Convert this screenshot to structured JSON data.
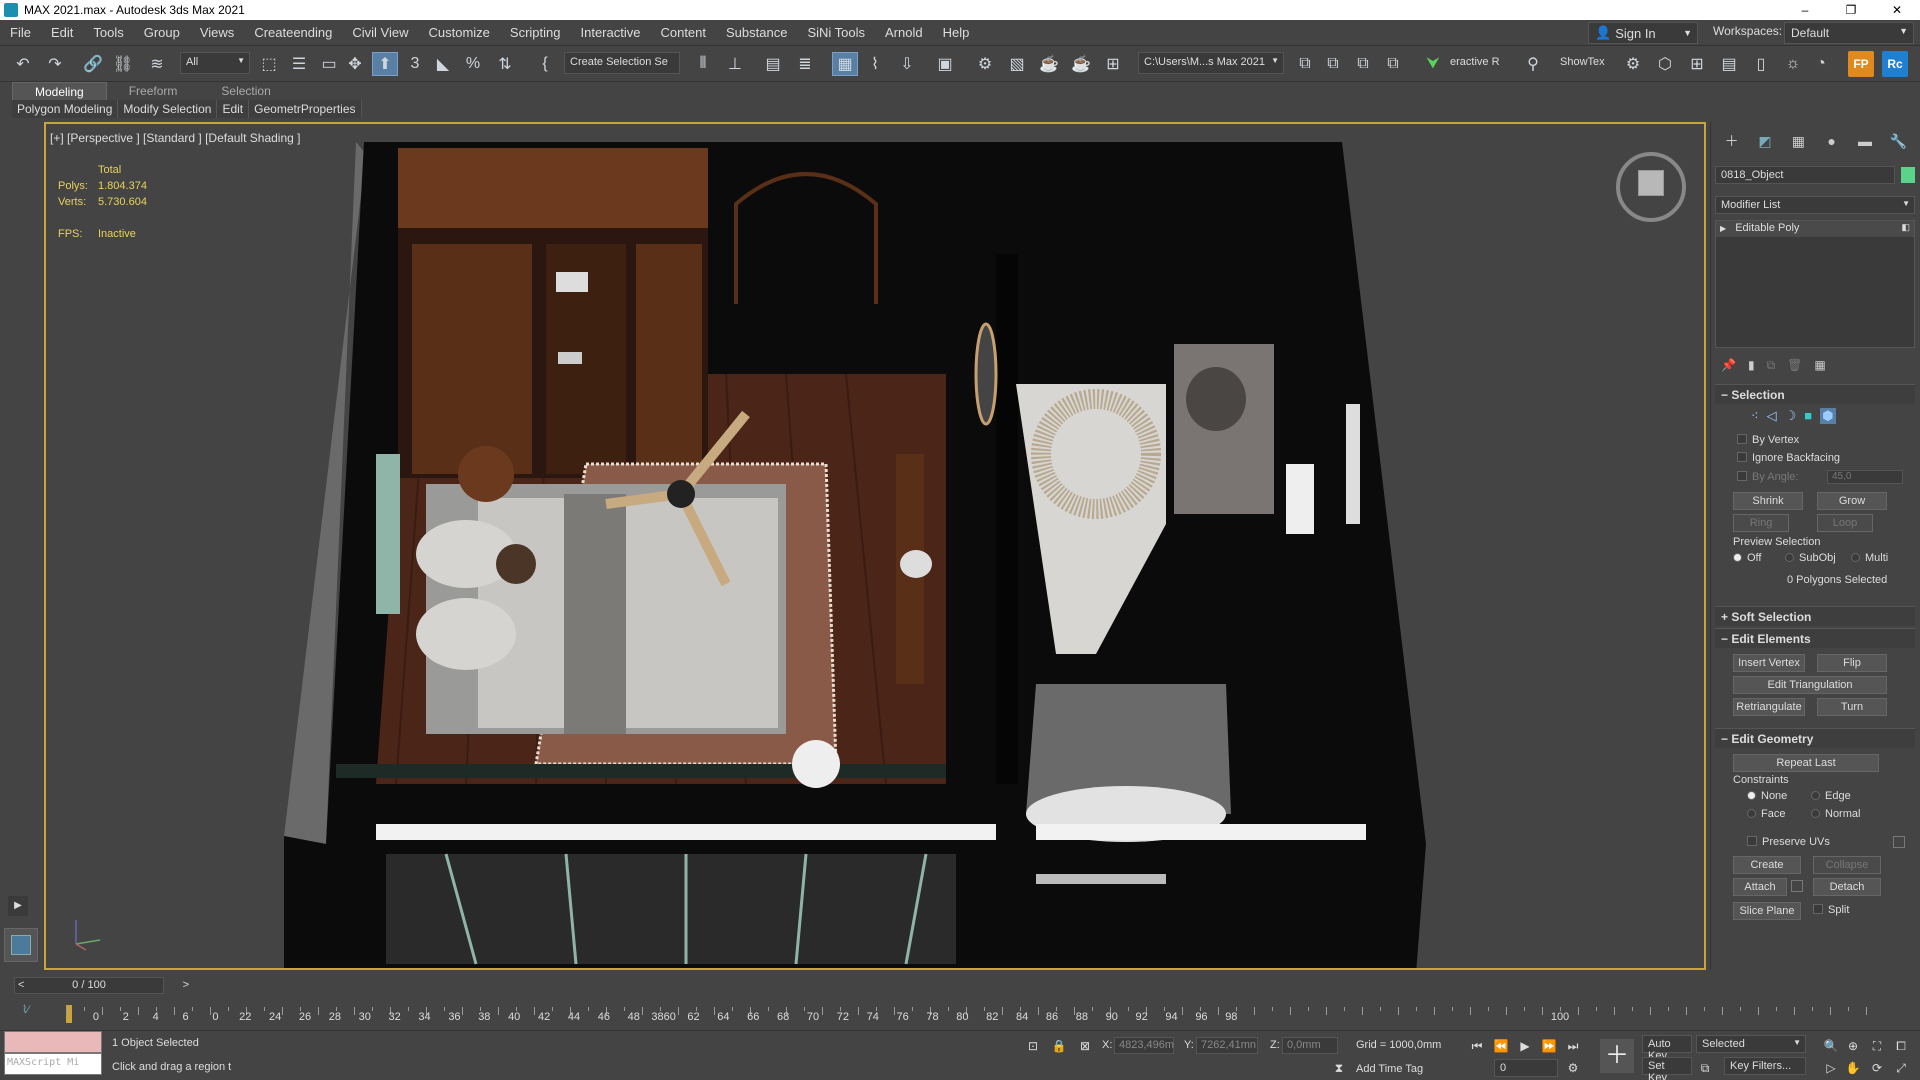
{
  "window": {
    "title": "MAX 2021.max - Autodesk 3ds Max 2021",
    "controls": [
      "–",
      "❐",
      "✕"
    ]
  },
  "menu": {
    "items": [
      "File",
      "Edit",
      "Tools",
      "Group",
      "Views",
      "Createending",
      "Civil View",
      "Customize",
      "Scripting",
      "Interactive",
      "Content",
      "Substance",
      "SiNi Tools",
      "Arnold",
      "Help"
    ],
    "sign_in": "Sign In",
    "workspaces_label": "Workspaces:",
    "workspace_value": "Default"
  },
  "toolbar": {
    "filter_value": "All",
    "selection_set_placeholder": "Create Selection Se",
    "path_value": "C:\\Users\\M...s Max 2021",
    "interactive_label": "eractive R",
    "showtex_label": "ShowTex",
    "fp_label": "FP",
    "rc_label": "Rc"
  },
  "ribbon": {
    "tabs": [
      "Modeling",
      "Freeform",
      "Selection"
    ],
    "subtabs": [
      "Polygon Modeling",
      "Modify Selection",
      "Edit",
      "GeometrProperties"
    ]
  },
  "viewport": {
    "label": "[+] [Perspective ] [Standard ] [Default Shading ]",
    "stats": {
      "total_label": "Total",
      "polys_label": "Polys:",
      "polys_value": "1.804.374",
      "verts_label": "Verts:",
      "verts_value": "5.730.604",
      "fps_label": "FPS:",
      "fps_value": "Inactive"
    }
  },
  "command_panel": {
    "object_name": "0818_Object",
    "object_color": "#5bd38a",
    "modifier_list_label": "Modifier List",
    "stack_item": "Editable Poly",
    "selection": {
      "title": "Selection",
      "by_vertex": "By Vertex",
      "ignore_backfacing": "Ignore Backfacing",
      "by_angle": "By Angle:",
      "angle_value": "45,0",
      "shrink": "Shrink",
      "grow": "Grow",
      "ring": "Ring",
      "loop": "Loop",
      "preview_selection": "Preview Selection",
      "preview_off": "Off",
      "preview_subobj": "SubObj",
      "preview_multi": "Multi",
      "status": "0 Polygons Selected"
    },
    "soft_selection_title": "Soft Selection",
    "edit_elements": {
      "title": "Edit Elements",
      "insert_vertex": "Insert Vertex",
      "flip": "Flip",
      "edit_triangulation": "Edit Triangulation",
      "retriangulate": "Retriangulate",
      "turn": "Turn"
    },
    "edit_geometry": {
      "title": "Edit Geometry",
      "repeat_last": "Repeat Last",
      "constraints": "Constraints",
      "none": "None",
      "edge": "Edge",
      "face": "Face",
      "normal": "Normal",
      "preserve_uvs": "Preserve UVs",
      "create": "Create",
      "collapse": "Collapse",
      "attach": "Attach",
      "detach": "Detach",
      "slice_plane": "Slice Plane",
      "split": "Split"
    }
  },
  "timeline": {
    "frame_display": "0 / 100",
    "prev": "<",
    "next": ">",
    "tick_labels": [
      "0",
      "2",
      "4",
      "6",
      "0",
      "22",
      "24",
      "26",
      "28",
      "30",
      "32",
      "34",
      "36",
      "38",
      "40",
      "42",
      "44",
      "46",
      "48",
      "3860",
      "62",
      "64",
      "66",
      "68",
      "70",
      "72",
      "74",
      "76",
      "78",
      "80",
      "82",
      "84",
      "86",
      "88",
      "90",
      "92",
      "94",
      "96",
      "98",
      "100"
    ]
  },
  "status": {
    "maxscript_placeholder": "MAXScript Mi",
    "selected_text": "1 Object Selected",
    "prompt_text": "Click and drag a region t",
    "x_label": "X:",
    "x_value": "4823,496m",
    "y_label": "Y:",
    "y_value": "7262,41mn",
    "z_label": "Z:",
    "z_value": "0,0mm",
    "grid": "Grid = 1000,0mm",
    "add_time_tag": "Add Time Tag",
    "auto_key": "Auto Key",
    "set_key": "Set Key",
    "key_mode_value": "Selected",
    "key_filters": "Key Filters...",
    "frame_value": "0"
  }
}
